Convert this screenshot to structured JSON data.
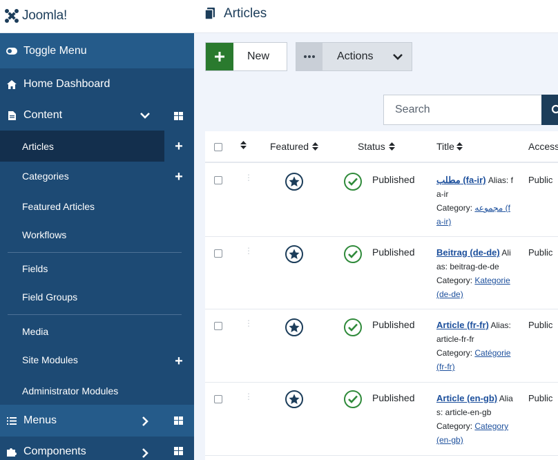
{
  "header": {
    "logo_text": "Joomla!",
    "page_title": "Articles"
  },
  "sidebar": {
    "toggle_label": "Toggle Menu",
    "home_label": "Home Dashboard",
    "content_label": "Content",
    "content_items": [
      {
        "label": "Articles",
        "active": true,
        "has_plus": true
      },
      {
        "label": "Categories",
        "active": false,
        "has_plus": true
      },
      {
        "label": "Featured Articles",
        "active": false,
        "has_plus": false
      },
      {
        "label": "Workflows",
        "active": false,
        "has_plus": false
      },
      {
        "label": "Fields",
        "active": false,
        "has_plus": false
      },
      {
        "label": "Field Groups",
        "active": false,
        "has_plus": false
      },
      {
        "label": "Media",
        "active": false,
        "has_plus": false
      },
      {
        "label": "Site Modules",
        "active": false,
        "has_plus": true
      },
      {
        "label": "Administrator Modules",
        "active": false,
        "has_plus": false
      }
    ],
    "menus_label": "Menus",
    "components_label": "Components"
  },
  "toolbar": {
    "new_label": "New",
    "actions_label": "Actions"
  },
  "search": {
    "placeholder": "Search"
  },
  "table": {
    "headers": {
      "featured": "Featured",
      "status": "Status",
      "title": "Title",
      "access": "Access"
    },
    "rows": [
      {
        "title": "مطلب (fa-ir)",
        "alias": "Alias: fa-ir",
        "category_label": "Category:",
        "category": "مجموعه (fa-ir)",
        "status": "Published",
        "access": "Public"
      },
      {
        "title": "Beitrag (de-de)",
        "alias": "Alias: beitrag-de-de",
        "category_label": "Category:",
        "category": "Kategorie (de-de)",
        "status": "Published",
        "access": "Public"
      },
      {
        "title": "Article (fr-fr)",
        "alias": "Alias: article-fr-fr",
        "category_label": "Category:",
        "category": "Catégorie (fr-fr)",
        "status": "Published",
        "access": "Public"
      },
      {
        "title": "Article (en-gb)",
        "alias": "Alias: article-en-gb",
        "category_label": "Category:",
        "category": "Category (en-gb)",
        "status": "Published",
        "access": "Public"
      }
    ]
  },
  "colors": {
    "sidebar_bg": "#1d4a74",
    "sidebar_active": "#132f4d",
    "new_green": "#2a7a2e",
    "link_blue": "#1c4f9c",
    "status_green": "#2f8a3a"
  }
}
